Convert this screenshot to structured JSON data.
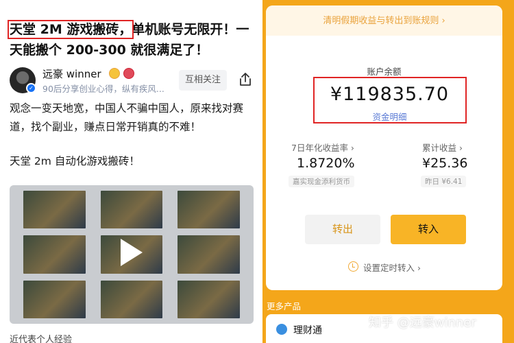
{
  "article": {
    "title_highlight": "天堂 2M 游戏搬砖，",
    "title_rest": "单机账号无限开！一天能搬个 200-300 就很满足了！",
    "author": {
      "name": "远豪 winner",
      "description": "90后分享创业心得，纵有疾风...",
      "follow_label": "互相关注"
    },
    "paragraph_1": "观念一变天地宽，中国人不骗中国人，原来找对赛道，找个副业，赚点日常开销真的不难！",
    "paragraph_2": "天堂 2m 自动化游戏搬砖！",
    "caption": "近代表个人经验"
  },
  "wallet": {
    "notice": "清明假期收益与转出到账规则 ›",
    "balance_label": "账户余额",
    "balance_value": "¥119835.70",
    "balance_detail": "资金明细",
    "rate_label": "7日年化收益率 ›",
    "rate_value": "1.8720%",
    "rate_sub": "嘉实现金添利货币",
    "income_label": "累计收益 ›",
    "income_value": "¥25.36",
    "income_sub": "昨日 ¥6.41",
    "btn_out": "转出",
    "btn_in": "转入",
    "timer": "设置定时转入 ›",
    "more_label": "更多产品",
    "product_name": "理财通",
    "watermark": "知乎 @远豪winner",
    "colors": {
      "accent": "#f4a61a",
      "highlight_border": "#e02424",
      "link": "#5b7bd5"
    }
  }
}
